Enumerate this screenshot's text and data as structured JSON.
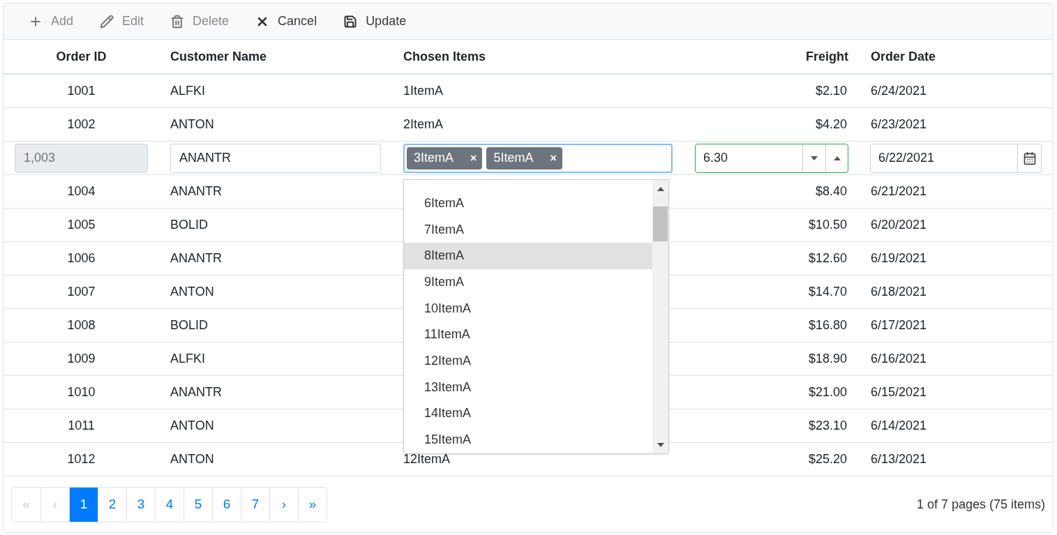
{
  "toolbar": [
    {
      "label": "Add",
      "disabled": true
    },
    {
      "label": "Edit",
      "disabled": true
    },
    {
      "label": "Delete",
      "disabled": true
    },
    {
      "label": "Cancel",
      "disabled": false
    },
    {
      "label": "Update",
      "disabled": false
    }
  ],
  "columns": [
    "Order ID",
    "Customer Name",
    "Chosen Items",
    "Freight",
    "Order Date"
  ],
  "rows": [
    {
      "kind": "data",
      "order_id": "1001",
      "customer": "ALFKI",
      "items": "1ItemA",
      "freight": "$2.10",
      "date": "6/24/2021"
    },
    {
      "kind": "data",
      "order_id": "1002",
      "customer": "ANTON",
      "items": "2ItemA",
      "freight": "$4.20",
      "date": "6/23/2021"
    },
    {
      "kind": "edit",
      "order_id": "1,003",
      "customer": "ANANTR",
      "chips": [
        {
          "label": "3ItemA",
          "remove": "×"
        },
        {
          "label": "5ItemA",
          "remove": "×"
        }
      ],
      "freight": "6.30",
      "date": "6/22/2021",
      "dropdown": [
        {
          "label": "6ItemA",
          "highlighted": false
        },
        {
          "label": "7ItemA",
          "highlighted": false
        },
        {
          "label": "8ItemA",
          "highlighted": true
        },
        {
          "label": "9ItemA",
          "highlighted": false
        },
        {
          "label": "10ItemA",
          "highlighted": false
        },
        {
          "label": "11ItemA",
          "highlighted": false
        },
        {
          "label": "12ItemA",
          "highlighted": false
        },
        {
          "label": "13ItemA",
          "highlighted": false
        },
        {
          "label": "14ItemA",
          "highlighted": false
        },
        {
          "label": "15ItemA",
          "highlighted": false
        }
      ]
    },
    {
      "kind": "data",
      "order_id": "1004",
      "customer": "ANANTR",
      "freight": "$8.40",
      "date": "6/21/2021"
    },
    {
      "kind": "data",
      "order_id": "1005",
      "customer": "BOLID",
      "freight": "$10.50",
      "date": "6/20/2021"
    },
    {
      "kind": "data",
      "order_id": "1006",
      "customer": "ANANTR",
      "freight": "$12.60",
      "date": "6/19/2021"
    },
    {
      "kind": "data",
      "order_id": "1007",
      "customer": "ANTON",
      "freight": "$14.70",
      "date": "6/18/2021"
    },
    {
      "kind": "data",
      "order_id": "1008",
      "customer": "BOLID",
      "freight": "$16.80",
      "date": "6/17/2021"
    },
    {
      "kind": "data",
      "order_id": "1009",
      "customer": "ALFKI",
      "freight": "$18.90",
      "date": "6/16/2021"
    },
    {
      "kind": "data",
      "order_id": "1010",
      "customer": "ANANTR",
      "freight": "$21.00",
      "date": "6/15/2021"
    },
    {
      "kind": "data",
      "order_id": "1011",
      "customer": "ANTON",
      "freight": "$23.10",
      "date": "6/14/2021"
    },
    {
      "kind": "data",
      "order_id": "1012",
      "customer": "ANTON",
      "items": "12ItemA",
      "freight": "$25.20",
      "date": "6/13/2021"
    }
  ],
  "pager": {
    "buttons": [
      {
        "label": "«",
        "disabled": true,
        "selected": false
      },
      {
        "label": "‹",
        "disabled": true,
        "selected": false
      },
      {
        "label": "1",
        "disabled": false,
        "selected": true
      },
      {
        "label": "2",
        "disabled": false,
        "selected": false
      },
      {
        "label": "3",
        "disabled": false,
        "selected": false
      },
      {
        "label": "4",
        "disabled": false,
        "selected": false
      },
      {
        "label": "5",
        "disabled": false,
        "selected": false
      },
      {
        "label": "6",
        "disabled": false,
        "selected": false
      },
      {
        "label": "7",
        "disabled": false,
        "selected": false
      },
      {
        "label": "›",
        "disabled": false,
        "selected": false
      },
      {
        "label": "»",
        "disabled": false,
        "selected": false
      }
    ],
    "summary": "1 of 7 pages (75 items)"
  }
}
